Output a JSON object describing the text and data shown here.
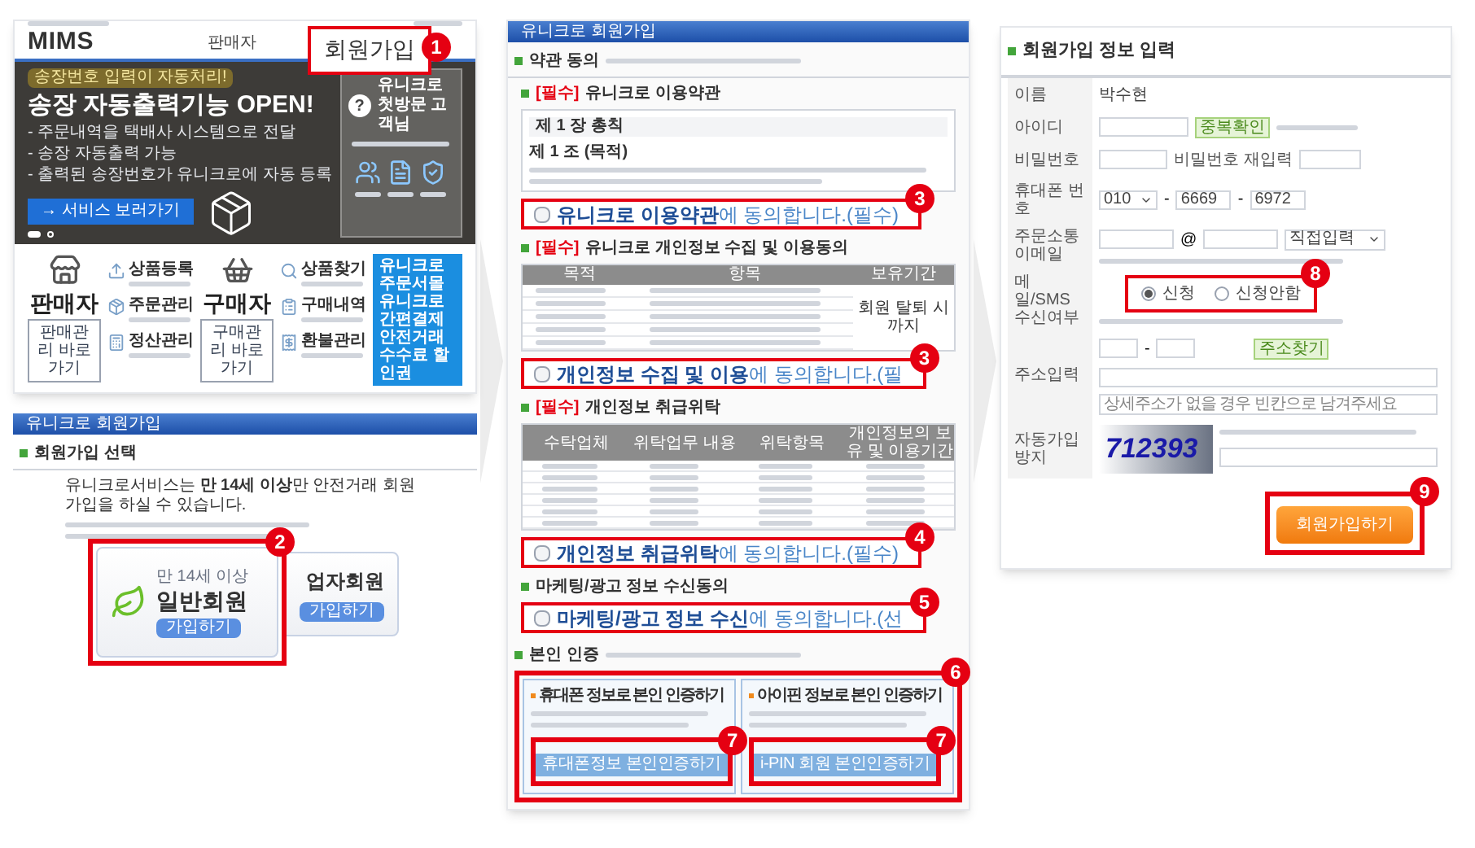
{
  "home_page": {
    "logo": "MIMS",
    "nav_item": "판매자",
    "signup_callout": {
      "label": "회원가입",
      "step": "1"
    },
    "banner": {
      "tag": "송장번호 입력이 자동처리!",
      "title": "송장 자동출력기능 OPEN!",
      "bullets": [
        "- 주문내역을 택배사 시스템으로 전달",
        "- 송장 자동출력 가능",
        "- 출력된 송장번호가 유니크로에 자동 등록"
      ],
      "button": "→ 서비스 보러가기",
      "slide_dots": [
        {
          "selected": true
        },
        {
          "selected": false
        }
      ],
      "guide_card": {
        "icon": "?",
        "title": "유니크로 첫방문 고객님"
      }
    },
    "seller": {
      "title": "판매자",
      "button": "판매관리 바로가기",
      "items": [
        "상품등록",
        "주문관리",
        "정산관리"
      ]
    },
    "buyer": {
      "title": "구매자",
      "button": "구매관리 바로가기",
      "items": [
        "상품찾기",
        "구매내역",
        "환불관리"
      ]
    },
    "promos": [
      "유니크로 주문서몰",
      "유니크로 간편결제",
      "안전거래수수료 할인권"
    ]
  },
  "member_type_page": {
    "header": "유니크로 회원가입",
    "section_title": "회원가입 선택",
    "notice": "유니크로서비스는 **만 14세 이상**만 안전거래 회원가입을 하실 수 있습니다.",
    "business_card": {
      "title": "업자회원",
      "button": "가입하기"
    },
    "general_card": {
      "age_note": "만 14세 이상",
      "title": "일반회원",
      "button": "가입하기",
      "step": "2"
    }
  },
  "terms_page": {
    "header": "유니크로 회원가입",
    "section_title": "약관 동의",
    "sections": [
      {
        "kind": "terms",
        "tag": "[필수]",
        "label": "유니크로 이용약관",
        "chapter": "제 1 장 총칙",
        "article": "제 1 조 (목적)",
        "agree": {
          "text": "**유니크로 이용약관**에 동의합니다.(필수)",
          "checked": false,
          "step": "3"
        }
      },
      {
        "kind": "collect_table",
        "tag": "[필수]",
        "label": "유니크로 개인정보 수집 및 이용동의",
        "columns": [
          "목적",
          "항목",
          "보유기간"
        ],
        "retention": "회원 탈퇴 시 까지",
        "agree": {
          "text": "**개인정보 수집 및 이용**에 동의합니다.(필",
          "checked": false,
          "step": "3"
        }
      },
      {
        "kind": "outsource_table",
        "tag": "[필수]",
        "label": "개인정보 취급위탁",
        "columns": [
          "수탁업체",
          "위탁업무 내용",
          "위탁항목",
          "개인정보의 보유 및 이용기간"
        ],
        "agree": {
          "text": "**개인정보 취급위탁**에 동의합니다.(필수)",
          "checked": false,
          "step": "4"
        }
      },
      {
        "kind": "marketing",
        "label": "마케팅/광고 정보 수신동의",
        "agree": {
          "text": "**마케팅/광고 정보 수신**에 동의합니다.(선",
          "checked": false,
          "step": "5"
        }
      }
    ],
    "verification": {
      "label": "본인 인증",
      "step": "6",
      "methods": [
        {
          "title": "휴대폰 정보로 본인 인증하기",
          "button": "휴대폰정보 본인인증하기",
          "step": "7"
        },
        {
          "title": "아이핀 정보로 본인 인증하기",
          "button": "i-PIN 회원 본인인증하기",
          "step": "7"
        }
      ]
    }
  },
  "signup_form": {
    "title": "회원가입 정보 입력",
    "fields": [
      {
        "kind": "text",
        "label": "이름",
        "value": "박수현"
      },
      {
        "kind": "id",
        "label": "아이디",
        "button": "중복확인"
      },
      {
        "kind": "password",
        "label": "비밀번호",
        "confirm_label": "비밀번호 재입력"
      },
      {
        "kind": "phone",
        "label": "휴대폰 번호",
        "prefix": "010",
        "middle": "6669",
        "last": "6972",
        "separator": "-"
      },
      {
        "kind": "email",
        "label": "주문소통 이메일",
        "at": "@",
        "domain_select": "직접입력"
      },
      {
        "kind": "radio",
        "label": "메일/SMS 수신여부",
        "step": "8",
        "options": [
          {
            "label": "신청",
            "selected": true
          },
          {
            "label": "신청안함",
            "selected": false
          }
        ]
      },
      {
        "kind": "address",
        "label": "주소입력",
        "separator": "-",
        "button": "주소찾기",
        "placeholder": "상세주소가 없을 경우 빈칸으로 남겨주세요"
      },
      {
        "kind": "captcha",
        "label": "자동가입 방지",
        "code": "712393"
      }
    ],
    "submit": {
      "label": "회원가입하기",
      "step": "9"
    }
  }
}
